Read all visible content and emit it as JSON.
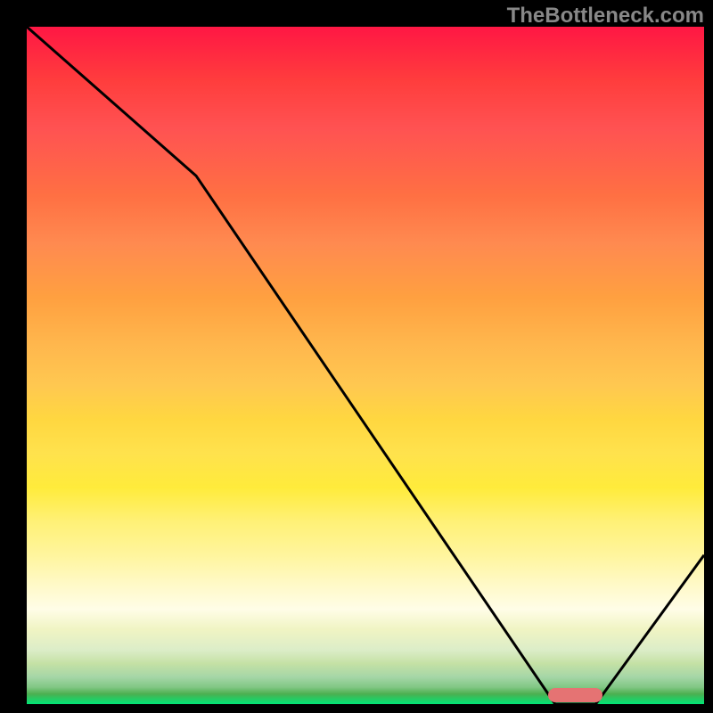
{
  "watermark": "TheBottleneck.com",
  "chart_data": {
    "type": "line",
    "title": "",
    "xlabel": "",
    "ylabel": "",
    "xlim": [
      0,
      100
    ],
    "ylim": [
      0,
      100
    ],
    "x": [
      0,
      25,
      78,
      84,
      100
    ],
    "values": [
      100,
      78,
      0,
      0,
      22
    ],
    "optimal_range_x": [
      77,
      85
    ],
    "gradient_stops": [
      {
        "pct": 0,
        "color": "#ff1744"
      },
      {
        "pct": 50,
        "color": "#ffd740"
      },
      {
        "pct": 85,
        "color": "#fffde7"
      },
      {
        "pct": 100,
        "color": "#00e676"
      }
    ],
    "marker": {
      "color": "#e57373",
      "shape": "rounded-bar"
    }
  }
}
